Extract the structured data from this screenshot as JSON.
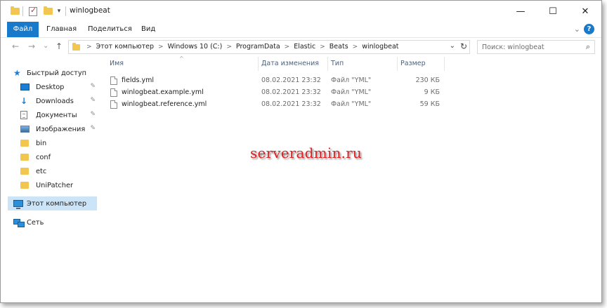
{
  "window": {
    "title": "winlogbeat",
    "controls": {
      "minimize": "—",
      "maximize": "☐",
      "close": "✕"
    }
  },
  "quick_access_toolbar": {
    "items": [
      {
        "icon": "folder-icon"
      },
      {
        "icon": "properties-icon"
      },
      {
        "icon": "new-folder-icon"
      },
      {
        "icon": "customize-dropdown-icon"
      }
    ],
    "dropdown_glyph": "▾"
  },
  "ribbon": {
    "tabs": [
      "Файл",
      "Главная",
      "Поделиться",
      "Вид"
    ],
    "expand_glyph": "⌄",
    "help_glyph": "?"
  },
  "navigation": {
    "back": "←",
    "forward": "→",
    "recent": "⌄",
    "up": "↑"
  },
  "address": {
    "breadcrumbs": [
      "Этот компьютер",
      "Windows 10 (C:)",
      "ProgramData",
      "Elastic",
      "Beats",
      "winlogbeat"
    ],
    "separator": ">",
    "dropdown_glyph": "⌄",
    "refresh_glyph": "↻"
  },
  "search": {
    "placeholder": "Поиск: winlogbeat",
    "icon_glyph": "⌕"
  },
  "sidebar": {
    "quick_access_label": "Быстрый доступ",
    "pin_glyph": "✎",
    "items": [
      {
        "label": "Desktop",
        "icon": "desktop-icon",
        "pinned": true
      },
      {
        "label": "Downloads",
        "icon": "downloads-icon",
        "pinned": true
      },
      {
        "label": "Документы",
        "icon": "documents-icon",
        "pinned": true
      },
      {
        "label": "Изображения",
        "icon": "pictures-icon",
        "pinned": true
      },
      {
        "label": "bin",
        "icon": "folder-icon",
        "pinned": false
      },
      {
        "label": "conf",
        "icon": "folder-icon",
        "pinned": false
      },
      {
        "label": "etc",
        "icon": "folder-icon",
        "pinned": false
      },
      {
        "label": "UniPatcher",
        "icon": "folder-icon",
        "pinned": false
      }
    ],
    "this_pc_label": "Этот компьютер",
    "network_label": "Сеть"
  },
  "columns": {
    "name": "Имя",
    "date": "Дата изменения",
    "type": "Тип",
    "size": "Размер",
    "sort_glyph": "^"
  },
  "files": [
    {
      "name": "fields.yml",
      "date": "08.02.2021 23:32",
      "type": "Файл \"YML\"",
      "size": "230 КБ"
    },
    {
      "name": "winlogbeat.example.yml",
      "date": "08.02.2021 23:32",
      "type": "Файл \"YML\"",
      "size": "9 КБ"
    },
    {
      "name": "winlogbeat.reference.yml",
      "date": "08.02.2021 23:32",
      "type": "Файл \"YML\"",
      "size": "59 КБ"
    }
  ],
  "watermark": "serveradmin.ru",
  "colors": {
    "accent": "#1979ca",
    "selected_background": "#cce4f7",
    "folder": "#f3c64f",
    "watermark": "#e02020"
  }
}
